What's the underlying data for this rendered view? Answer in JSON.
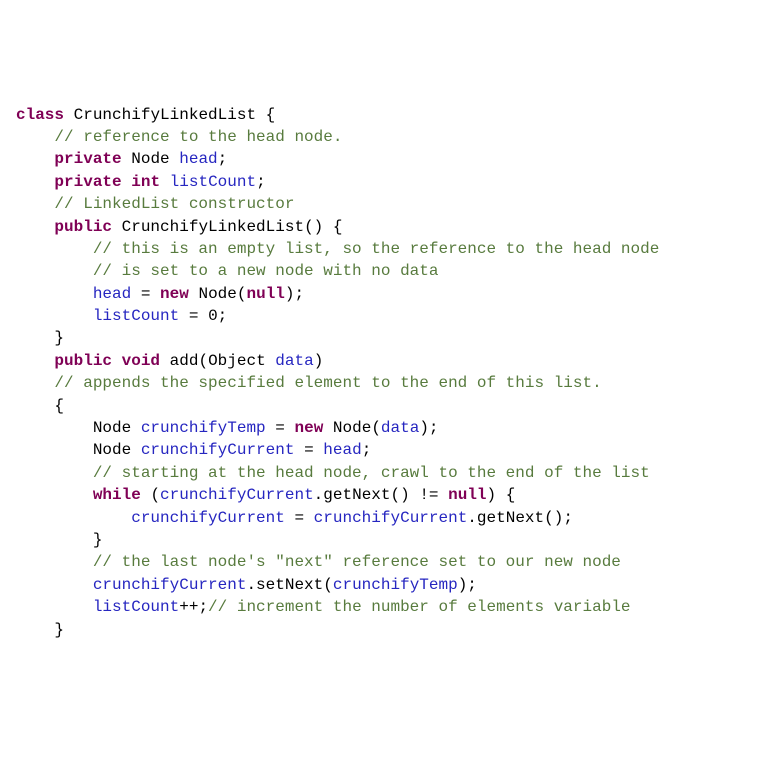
{
  "code": {
    "lines": [
      {
        "indent": 0,
        "html": "<span class='kw'>class</span> <span class='typ'>CrunchifyLinkedList</span> <span class='p'>{</span>"
      },
      {
        "indent": 1,
        "html": "<span class='cmt'>// reference to the head node.</span>"
      },
      {
        "indent": 1,
        "html": "<span class='kw'>private</span> <span class='typ'>Node</span> <span class='id'>head</span><span class='p'>;</span>"
      },
      {
        "indent": 1,
        "html": "<span class='kw'>private</span> <span class='kw'>int</span> <span class='id'>listCount</span><span class='p'>;</span>"
      },
      {
        "indent": 0,
        "html": ""
      },
      {
        "indent": 1,
        "html": "<span class='cmt'>// LinkedList constructor</span>"
      },
      {
        "indent": 1,
        "html": "<span class='kw'>public</span> <span class='typ'>CrunchifyLinkedList</span><span class='p'>() {</span>"
      },
      {
        "indent": 2,
        "html": "<span class='cmt'>// this is an empty list, so the reference to the head node</span>"
      },
      {
        "indent": 2,
        "html": "<span class='cmt'>// is set to a new node with no data</span>"
      },
      {
        "indent": 2,
        "html": "<span class='id'>head</span> <span class='p'>=</span> <span class='kw'>new</span> <span class='typ'>Node</span><span class='p'>(</span><span class='kw'>null</span><span class='p'>);</span>"
      },
      {
        "indent": 2,
        "html": "<span class='id'>listCount</span> <span class='p'>=</span> <span class='p'>0;</span>"
      },
      {
        "indent": 1,
        "html": "<span class='p'>}</span>"
      },
      {
        "indent": 0,
        "html": ""
      },
      {
        "indent": 1,
        "html": "<span class='kw'>public</span> <span class='kw'>void</span> <span class='typ'>add</span><span class='p'>(</span><span class='typ'>Object</span> <span class='id'>data</span><span class='p'>)</span>"
      },
      {
        "indent": 1,
        "html": "<span class='cmt'>// appends the specified element to the end of this list.</span>"
      },
      {
        "indent": 1,
        "html": "<span class='p'>{</span>"
      },
      {
        "indent": 2,
        "html": "<span class='typ'>Node</span> <span class='id'>crunchifyTemp</span> <span class='p'>=</span> <span class='kw'>new</span> <span class='typ'>Node</span><span class='p'>(</span><span class='id'>data</span><span class='p'>);</span>"
      },
      {
        "indent": 2,
        "html": "<span class='typ'>Node</span> <span class='id'>crunchifyCurrent</span> <span class='p'>=</span> <span class='id'>head</span><span class='p'>;</span>"
      },
      {
        "indent": 2,
        "html": "<span class='cmt'>// starting at the head node, crawl to the end of the list</span>"
      },
      {
        "indent": 2,
        "html": "<span class='kw'>while</span> <span class='p'>(</span><span class='id'>crunchifyCurrent</span><span class='p'>.</span><span class='typ'>getNext</span><span class='p'>()</span> <span class='p'>!=</span> <span class='kw'>null</span><span class='p'>) {</span>"
      },
      {
        "indent": 3,
        "html": "<span class='id'>crunchifyCurrent</span> <span class='p'>=</span> <span class='id'>crunchifyCurrent</span><span class='p'>.</span><span class='typ'>getNext</span><span class='p'>();</span>"
      },
      {
        "indent": 2,
        "html": "<span class='p'>}</span>"
      },
      {
        "indent": 2,
        "html": "<span class='cmt'>// the last node's \"next\" reference set to our new node</span>"
      },
      {
        "indent": 2,
        "html": "<span class='id'>crunchifyCurrent</span><span class='p'>.</span><span class='typ'>setNext</span><span class='p'>(</span><span class='id'>crunchifyTemp</span><span class='p'>);</span>"
      },
      {
        "indent": 2,
        "html": "<span class='id'>listCount</span><span class='p'>++;</span><span class='cmt'>// increment the number of elements variable</span>"
      },
      {
        "indent": 1,
        "html": "<span class='p'>}</span>"
      }
    ],
    "indent_unit": "    "
  }
}
